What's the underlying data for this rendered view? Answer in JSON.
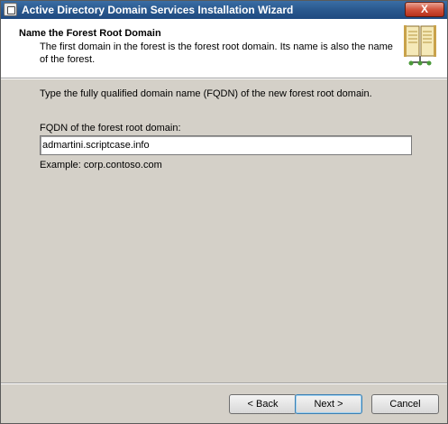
{
  "window": {
    "title": "Active Directory Domain Services Installation Wizard",
    "close_label": "X"
  },
  "header": {
    "title": "Name the Forest Root Domain",
    "description": "The first domain in the forest is the forest root domain. Its name is also the name of the forest.",
    "icon": "book-icon"
  },
  "main": {
    "instruction": "Type the fully qualified domain name (FQDN) of the new forest root domain.",
    "fqdn_label": "FQDN of the forest root domain:",
    "fqdn_value": "admartini.scriptcase.info",
    "example": "Example: corp.contoso.com"
  },
  "buttons": {
    "back": "< Back",
    "next": "Next >",
    "cancel": "Cancel"
  }
}
